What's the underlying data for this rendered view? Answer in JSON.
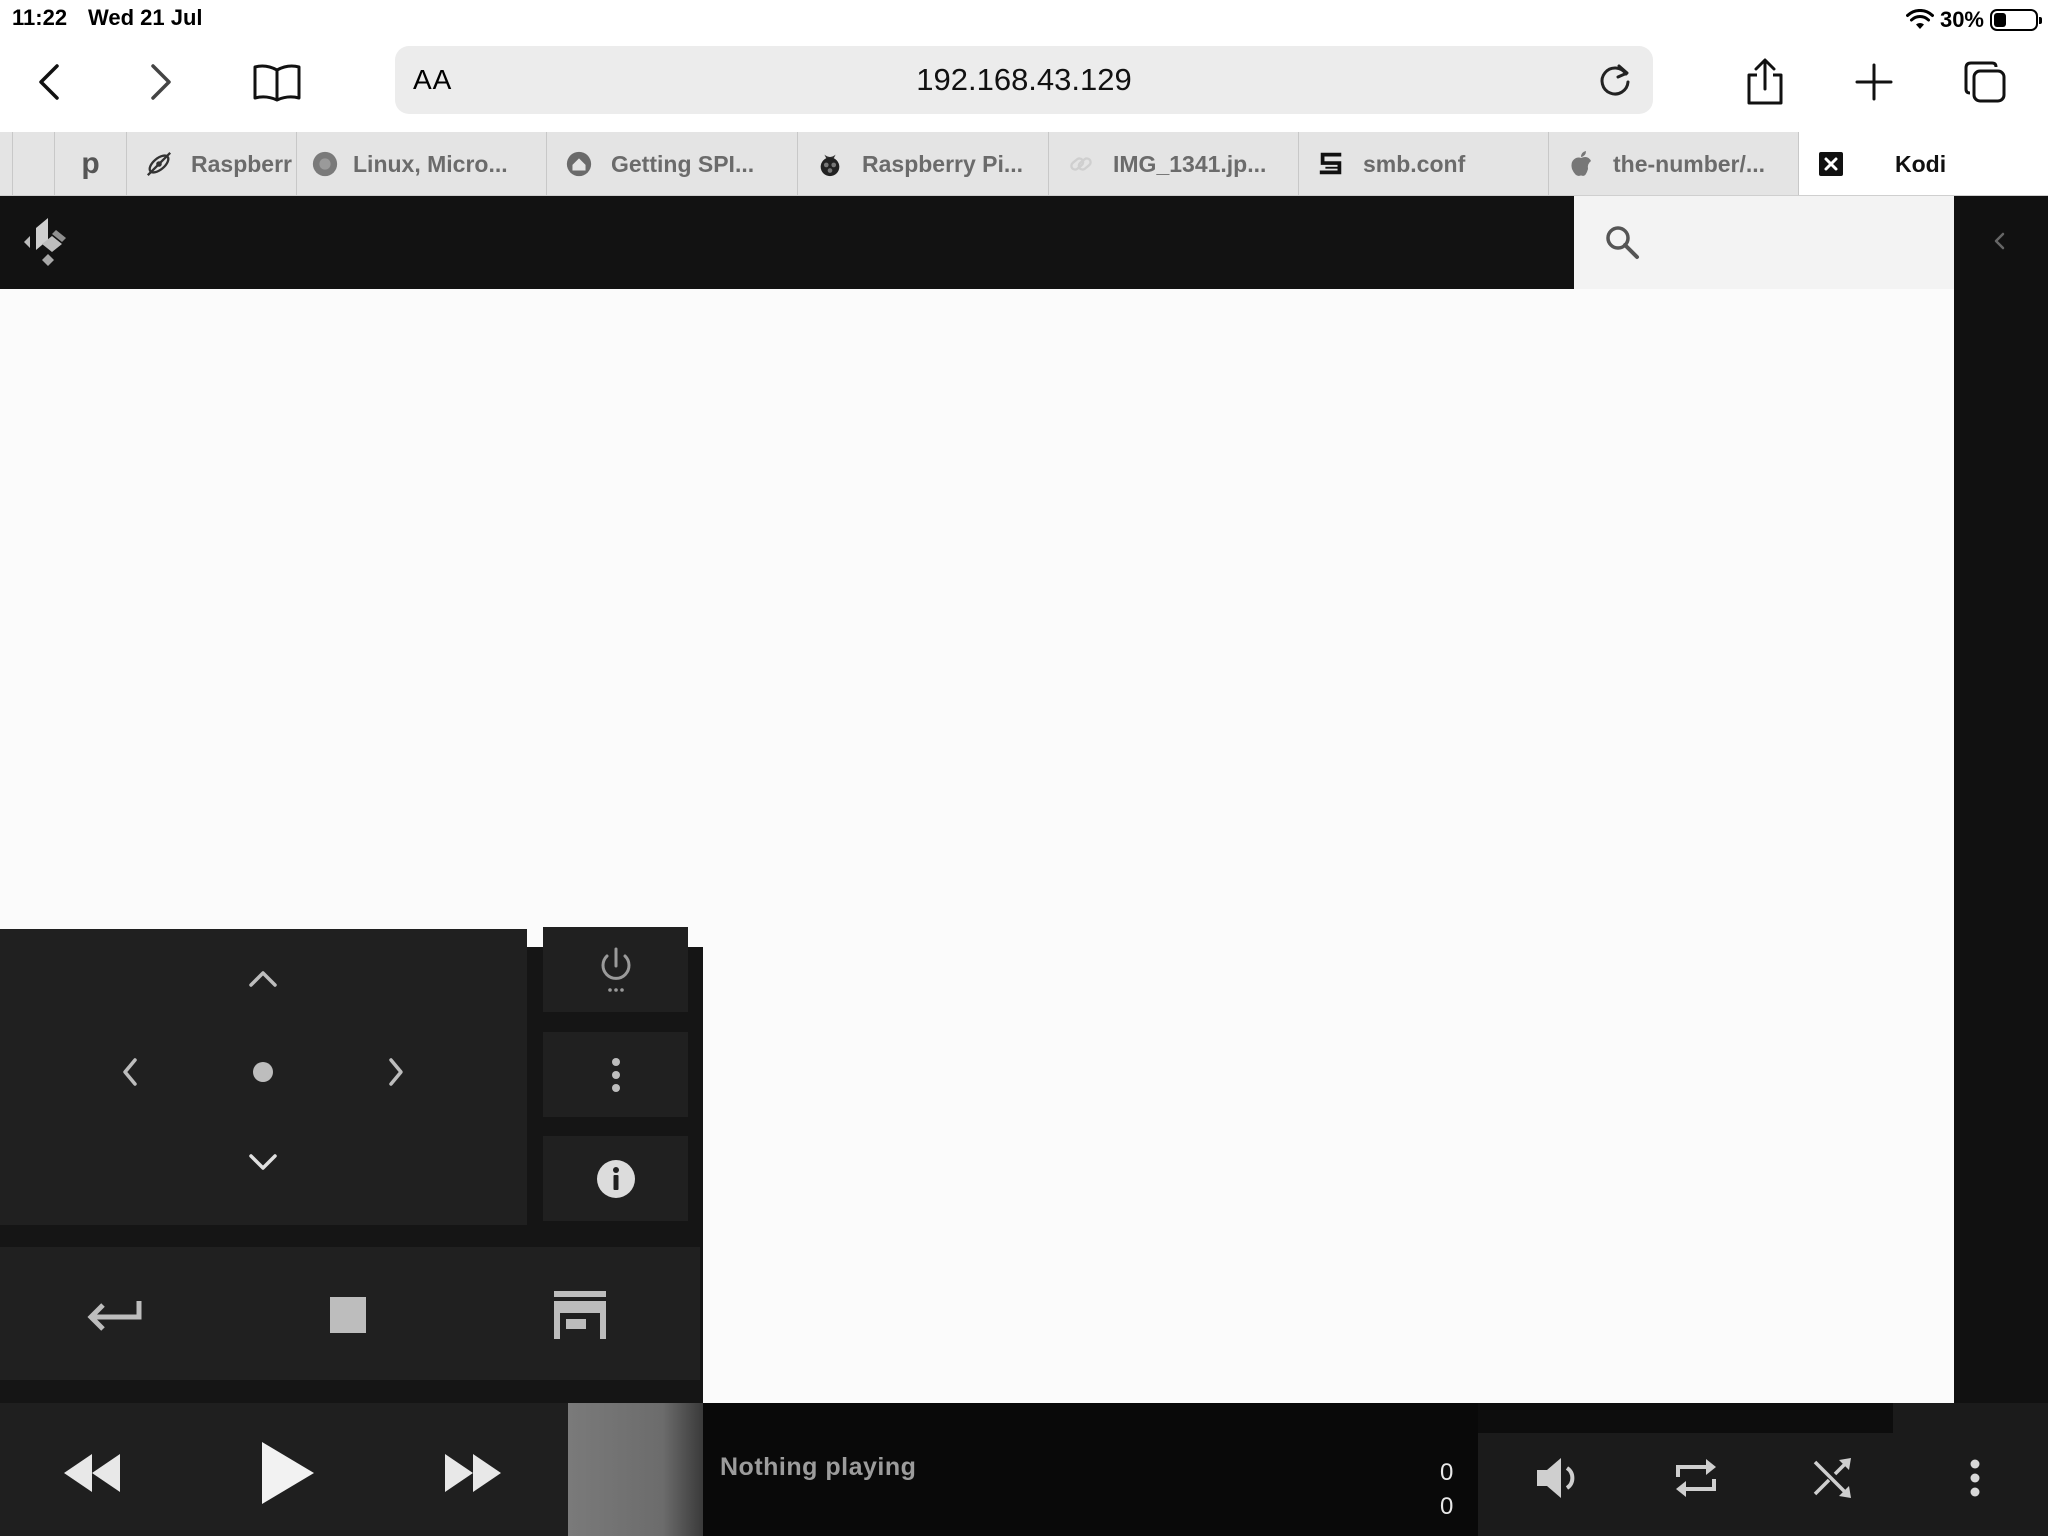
{
  "status_bar": {
    "time": "11:22",
    "date": "Wed 21 Jul",
    "battery_percent": "30%",
    "battery_level": 0.3
  },
  "toolbar": {
    "text_size_label": "AA",
    "url": "192.168.43.129"
  },
  "tabs": [
    {
      "label": "",
      "icon": "pinned-tab-icon"
    },
    {
      "label": "p",
      "icon": ""
    },
    {
      "label": "Raspberr",
      "icon": "satellite-icon"
    },
    {
      "label": "Linux, Micro...",
      "icon": "globe-icon"
    },
    {
      "label": "Getting SPI...",
      "icon": "home-icon"
    },
    {
      "label": "Raspberry Pi...",
      "icon": "raspberry-icon"
    },
    {
      "label": "IMG_1341.jp...",
      "icon": "link-icon"
    },
    {
      "label": "smb.conf",
      "icon": "s-logo-icon"
    },
    {
      "label": "the-number/...",
      "icon": "apple-icon"
    },
    {
      "label": "Kodi",
      "icon": "close-icon"
    }
  ],
  "kodi": {
    "now_playing": "Nothing playing",
    "time_elapsed": "0",
    "time_total": "0"
  }
}
